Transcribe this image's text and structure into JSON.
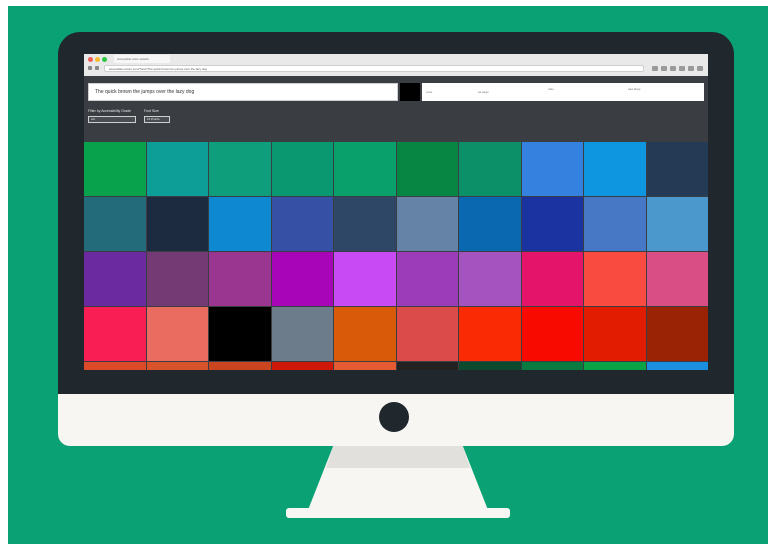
{
  "browser": {
    "tab_title": "Accessible color swatch",
    "address": "accessible-colors.com/?text=The quick brown fox jumps over the lazy dog"
  },
  "toolbar": {
    "sample_text": "The quick brown the jumps over the lazy dog",
    "preview_color": "#000000",
    "info_1": "color",
    "info_2": "aa large",
    "info_3": "ratio",
    "info_4": "aaa large",
    "filter_label": "Filter by Accessibility Grade",
    "filter_value": "AA",
    "font_label": "Font Size",
    "font_value": "14 Points"
  },
  "palette": [
    "#09a24c",
    "#0d9e97",
    "#0e9e7b",
    "#0a9870",
    "#0aa06c",
    "#078643",
    "#0b9068",
    "#3481e0",
    "#0f96e0",
    "#243a55",
    "#236b7a",
    "#1d2b40",
    "#0e88d0",
    "#3550a5",
    "#2e4766",
    "#6583a7",
    "#0a68b0",
    "#1a33a0",
    "#4778c5",
    "#4a98cc",
    "#6b2aa0",
    "#733a73",
    "#9b3690",
    "#a805b8",
    "#c74af5",
    "#9d3cb8",
    "#a553be",
    "#e4146a",
    "#f94b3f",
    "#d94e84",
    "#f91f55",
    "#ea6b60",
    "#000000",
    "#6c7c8a",
    "#d95b0a",
    "#da4b4a",
    "#fa2a05",
    "#f80a00",
    "#e21c00",
    "#9a2305",
    "#dd4a2a",
    "#d8532a",
    "#c84520",
    "#cf1808",
    "#e65a32",
    "#222222",
    "#0c4a30",
    "#0a7a40",
    "#0aa247",
    "#1a8fe0"
  ]
}
